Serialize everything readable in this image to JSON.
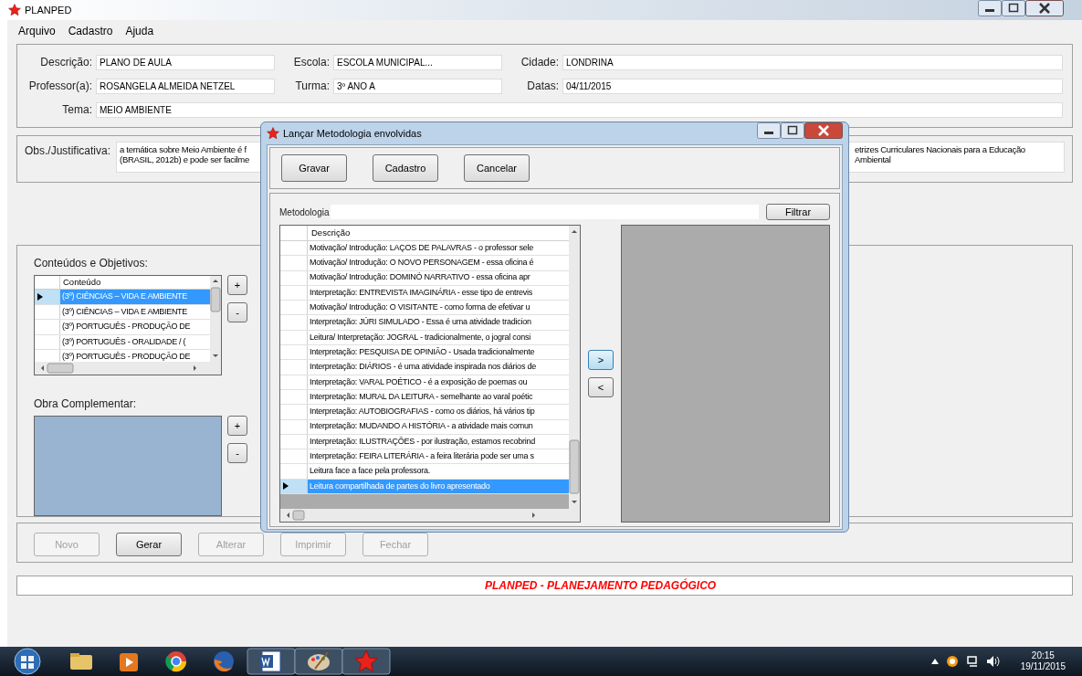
{
  "main_window": {
    "title": "PLANPED"
  },
  "menu": [
    "Arquivo",
    "Cadastro",
    "Ajuda"
  ],
  "header_rows": [
    [
      {
        "label": "Descrição:",
        "value": "PLANO DE AULA"
      },
      {
        "label": "Escola:",
        "value": "ESCOLA MUNICIPAL..."
      },
      {
        "label": "Cidade:",
        "value": "LONDRINA"
      }
    ],
    [
      {
        "label": "Professor(a):",
        "value": "ROSANGELA ALMEIDA NETZEL"
      },
      {
        "label": "Turma:",
        "value": "3º ANO A"
      },
      {
        "label": "Datas:",
        "value": "04/11/2015"
      }
    ],
    [
      {
        "label": "Tema:",
        "value": "MEIO AMBIENTE"
      }
    ]
  ],
  "observation": {
    "label": "Obs./Justificativa:",
    "lines_left": [
      "a temática sobre Meio Ambiente é f",
      "(BRASIL, 2012b) e pode ser facilme"
    ],
    "text_right": "etrizes Curriculares Nacionais para a Educação Ambiental"
  },
  "contents": {
    "label": "Conteúdos e Objetivos:",
    "column": "Conteúdo",
    "buttons": [
      "+",
      "-"
    ],
    "rows": [
      {
        "text": "(3º) CIÊNCIAS – VIDA E AMBIENTE",
        "selected": true
      },
      {
        "text": "(3º) CIÊNCIAS – VIDA E AMBIENTE",
        "selected": false
      },
      {
        "text": "(3º) PORTUGUÊS - PRODUÇÃO DE",
        "selected": false
      },
      {
        "text": "(3º) PORTUGUÊS - ORALIDADE / (",
        "selected": false
      },
      {
        "text": "(3º) PORTUGUÊS - PRODUÇÃO DE",
        "selected": false
      }
    ]
  },
  "complementary": {
    "label": "Obra Complementar:",
    "buttons": [
      "+",
      "-"
    ]
  },
  "actions": [
    {
      "label": "Novo",
      "disabled": true
    },
    {
      "label": "Gerar",
      "disabled": false
    },
    {
      "label": "Alterar",
      "disabled": true
    },
    {
      "label": "Imprimir",
      "disabled": true
    },
    {
      "label": "Fechar",
      "disabled": true
    }
  ],
  "status_text": "PLANPED - PLANEJAMENTO PEDAGÓGICO",
  "dialog": {
    "title": "Lançar Metodologia envolvidas",
    "buttons": [
      "Gravar",
      "Cadastro",
      "Cancelar"
    ],
    "filter_label": "Metodologia",
    "filter_button": "Filtrar",
    "column": "Descrição",
    "move_buttons": [
      ">",
      "<"
    ],
    "rows": [
      {
        "text": "Motivação/ Introdução: LAÇOS DE PALAVRAS - o professor sele",
        "selected": false
      },
      {
        "text": "Motivação/ Introdução: O NOVO PERSONAGEM - essa oficina é",
        "selected": false
      },
      {
        "text": "Motivação/ Introdução: DOMINÓ NARRATIVO - essa oficina apr",
        "selected": false
      },
      {
        "text": "Interpretação: ENTREVISTA IMAGINÁRIA - esse tipo de entrevis",
        "selected": false
      },
      {
        "text": "Motivação/ Introdução: O VISITANTE - como forma de efetivar u",
        "selected": false
      },
      {
        "text": "Interpretação: JÚRI SIMULADO - Essa é uma atividade tradicion",
        "selected": false
      },
      {
        "text": "Leitura/ Interpretação: JOGRAL - tradicionalmente, o jogral consi",
        "selected": false
      },
      {
        "text": "Interpretação: PESQUISA DE OPINIÃO - Usada tradicionalmente",
        "selected": false
      },
      {
        "text": "Interpretação: DIÁRIOS - é uma atividade inspirada nos diários de",
        "selected": false
      },
      {
        "text": "Interpretação: VARAL POÉTICO - é a exposição de poemas ou",
        "selected": false
      },
      {
        "text": "Interpretação: MURAL DA LEITURA - semelhante ao varal poétic",
        "selected": false
      },
      {
        "text": "Interpretação: AUTOBIOGRAFIAS - como os diários, há vários tip",
        "selected": false
      },
      {
        "text": "Interpretação: MUDANDO A HISTÓRIA - a atividade mais comun",
        "selected": false
      },
      {
        "text": "Interpretação: ILUSTRAÇÕES - por ilustração, estamos recobrind",
        "selected": false
      },
      {
        "text": "Interpretação: FEIRA LITERÁRIA - a feira literária pode ser uma s",
        "selected": false
      },
      {
        "text": "Leitura face a face pela professora.",
        "selected": false
      },
      {
        "text": "Leitura compartilhada de partes do livro apresentado",
        "selected": true
      }
    ]
  },
  "taskbar": {
    "time": "20:15",
    "date": "19/11/2015"
  }
}
